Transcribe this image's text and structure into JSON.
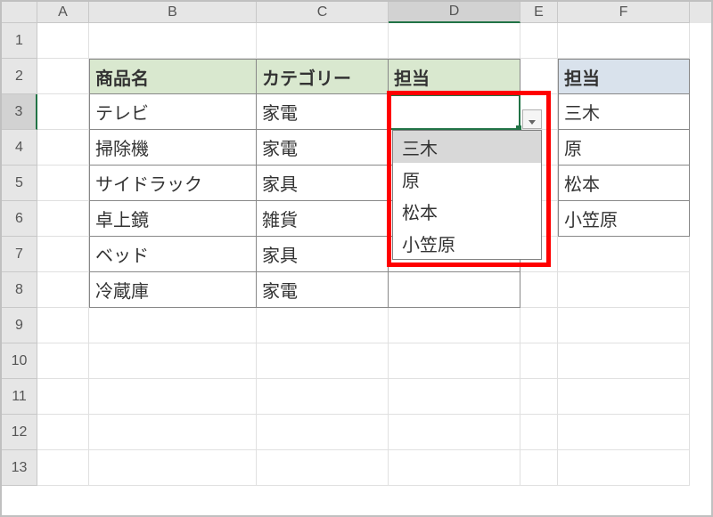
{
  "columns": {
    "A": "A",
    "B": "B",
    "C": "C",
    "D": "D",
    "E": "E",
    "F": "F"
  },
  "rows": {
    "1": "1",
    "2": "2",
    "3": "3",
    "4": "4",
    "5": "5",
    "6": "6",
    "7": "7",
    "8": "8",
    "9": "9",
    "10": "10",
    "11": "11",
    "12": "12",
    "13": "13"
  },
  "table1": {
    "headers": {
      "product": "商品名",
      "category": "カテゴリー",
      "assignee": "担当"
    },
    "rows": [
      {
        "product": "テレビ",
        "category": "家電",
        "assignee": ""
      },
      {
        "product": "掃除機",
        "category": "家電",
        "assignee": ""
      },
      {
        "product": "サイドラック",
        "category": "家具",
        "assignee": ""
      },
      {
        "product": "卓上鏡",
        "category": "雑貨",
        "assignee": ""
      },
      {
        "product": "ベッド",
        "category": "家具",
        "assignee": ""
      },
      {
        "product": "冷蔵庫",
        "category": "家電",
        "assignee": ""
      }
    ]
  },
  "table2": {
    "header": "担当",
    "items": [
      "三木",
      "原",
      "松本",
      "小笠原"
    ]
  },
  "dropdown": {
    "options": [
      "三木",
      "原",
      "松本",
      "小笠原"
    ],
    "selected_index": 0
  },
  "active_cell": "D3"
}
